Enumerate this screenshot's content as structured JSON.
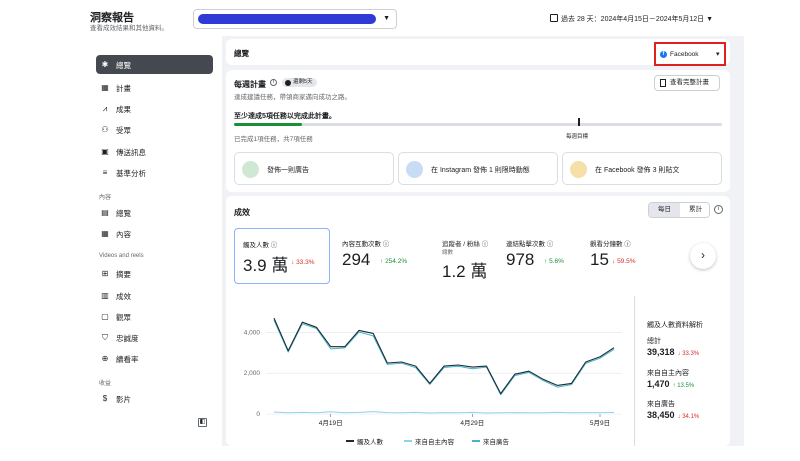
{
  "header": {
    "title": "洞察報告",
    "subtitle": "查看成效結果和其他資料。",
    "date_range": "過去 28 天：2024年4月15日－2024年5月12日"
  },
  "sidebar": {
    "items": [
      {
        "label": "總覽",
        "icon": "sparkle-icon"
      },
      {
        "label": "計畫",
        "icon": "calendar-icon"
      },
      {
        "label": "成果",
        "icon": "trend-icon"
      },
      {
        "label": "受眾",
        "icon": "people-icon"
      },
      {
        "label": "傳送訊息",
        "icon": "chat-icon"
      },
      {
        "label": "基準分析",
        "icon": "benchmark-icon"
      }
    ],
    "content_section": "內容",
    "content_items": [
      {
        "label": "總覽",
        "icon": "gallery-icon"
      },
      {
        "label": "內容",
        "icon": "grid-icon"
      }
    ],
    "video_section": "Videos and reels",
    "video_items": [
      {
        "label": "摘要",
        "icon": "summary-icon"
      },
      {
        "label": "成效",
        "icon": "list-icon"
      },
      {
        "label": "觀眾",
        "icon": "viewer-icon"
      },
      {
        "label": "忠誠度",
        "icon": "shield-icon"
      },
      {
        "label": "續看率",
        "icon": "retention-icon"
      }
    ],
    "revenue_section": "收益",
    "revenue_items": [
      {
        "label": "影片",
        "icon": "dollar-icon"
      }
    ]
  },
  "overview": {
    "title": "總覽",
    "platform": "Facebook"
  },
  "plan": {
    "title": "每週計畫",
    "badge": "還剩5天",
    "description": "達成建議任務，帶領商家邁向成功之路。",
    "view_button": "查看完整計畫",
    "goal": "至少達成5項任務以完成此計畫。",
    "progress_text": "已完成1項任務，共7項任務",
    "progress_fraction": 0.14,
    "weekly_goal_label": "每週目標",
    "tasks": [
      {
        "label": "發佈一則廣告"
      },
      {
        "label": "在 Instagram 發佈 1 則限時動態"
      },
      {
        "label": "在 Facebook 發佈 3 則貼文"
      }
    ]
  },
  "performance": {
    "title": "成效",
    "toggle_daily": "每日",
    "toggle_cumulative": "累計",
    "metrics": [
      {
        "label": "觸及人數",
        "value": "3.9 萬",
        "delta": "33.3%",
        "dir": "down"
      },
      {
        "label": "內容互動次數",
        "value": "294",
        "delta": "254.2%",
        "dir": "up"
      },
      {
        "label": "追蹤者 / 粉絲",
        "sub": "總數",
        "value": "1.2 萬",
        "delta": "",
        "dir": ""
      },
      {
        "label": "連結點擊次數",
        "value": "978",
        "delta": "5.6%",
        "dir": "up"
      },
      {
        "label": "觀看分鐘數",
        "value": "15",
        "delta": "59.5%",
        "dir": "down"
      }
    ]
  },
  "breakdown": {
    "title": "觸及人數資料解析",
    "total_label": "總計",
    "total_value": "39,318",
    "total_delta": "33.3%",
    "organic_label": "來自自主內容",
    "organic_value": "1,470",
    "organic_delta": "13.5%",
    "ads_label": "來自廣告",
    "ads_value": "38,450",
    "ads_delta": "34.1%"
  },
  "chart_data": {
    "type": "line",
    "x_ticks": [
      "4月19日",
      "4月29日",
      "5月9日"
    ],
    "y_ticks": [
      "0",
      "2,000",
      "4,000"
    ],
    "ylim": [
      0,
      5000
    ],
    "series": [
      {
        "name": "觸及人數",
        "color": "#1c2b36",
        "values": [
          4700,
          3100,
          4500,
          4250,
          3300,
          3300,
          4100,
          3950,
          2500,
          2550,
          2350,
          1500,
          2350,
          2400,
          2300,
          2350,
          1000,
          1950,
          2100,
          1700,
          1400,
          1500,
          2550,
          2800,
          3250
        ]
      },
      {
        "name": "來自自主內容",
        "color": "#8fd3e8",
        "values": [
          100,
          60,
          80,
          60,
          110,
          60,
          80,
          120,
          70,
          60,
          80,
          50,
          70,
          60,
          80,
          50,
          60,
          70,
          60,
          60,
          80,
          60,
          70,
          70,
          80
        ]
      },
      {
        "name": "來自廣告",
        "color": "#45b3c8",
        "values": [
          4600,
          3040,
          4420,
          4190,
          3190,
          3240,
          4020,
          3830,
          2430,
          2490,
          2270,
          1450,
          2280,
          2340,
          2220,
          2300,
          940,
          1880,
          2040,
          1640,
          1320,
          1440,
          2480,
          2730,
          3170
        ]
      }
    ]
  }
}
